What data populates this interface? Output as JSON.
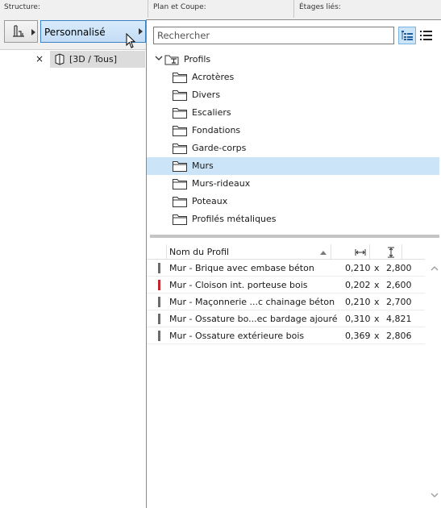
{
  "toolbar": {
    "structure_label": "Structure:",
    "plan_label": "Plan et Coupe:",
    "etages_label": "Étages liés:",
    "selected_profile": "Personnalisé"
  },
  "view": {
    "close": "×",
    "label": "[3D / Tous]"
  },
  "search": {
    "placeholder": "Rechercher"
  },
  "tree": {
    "root": "Profils",
    "folders": [
      "Acrotères",
      "Divers",
      "Escaliers",
      "Fondations",
      "Garde-corps",
      "Murs",
      "Murs-rideaux",
      "Poteaux",
      "Profilés métaliques"
    ],
    "selected": "Murs"
  },
  "table": {
    "col_name": "Nom du Profil",
    "rows": [
      {
        "name": "Mur - Brique avec embase béton",
        "w": "0,210",
        "x": "x",
        "h": "2,800",
        "color": "#6b6b6b"
      },
      {
        "name": "Mur - Cloison int. porteuse bois",
        "w": "0,202",
        "x": "x",
        "h": "2,600",
        "color": "#c4262e"
      },
      {
        "name": "Mur - Maçonnerie ...c chainage béton",
        "w": "0,210",
        "x": "x",
        "h": "2,700",
        "color": "#6b6b6b"
      },
      {
        "name": "Mur - Ossature bo...ec bardage ajouré",
        "w": "0,310",
        "x": "x",
        "h": "4,821",
        "color": "#6b6b6b"
      },
      {
        "name": "Mur - Ossature extérieure bois",
        "w": "0,369",
        "x": "x",
        "h": "2,806",
        "color": "#6b6b6b"
      }
    ]
  },
  "colors": {
    "accent": "#3b82c4",
    "selection": "#cce4f7",
    "highlight_button": "#c3ddf6"
  }
}
